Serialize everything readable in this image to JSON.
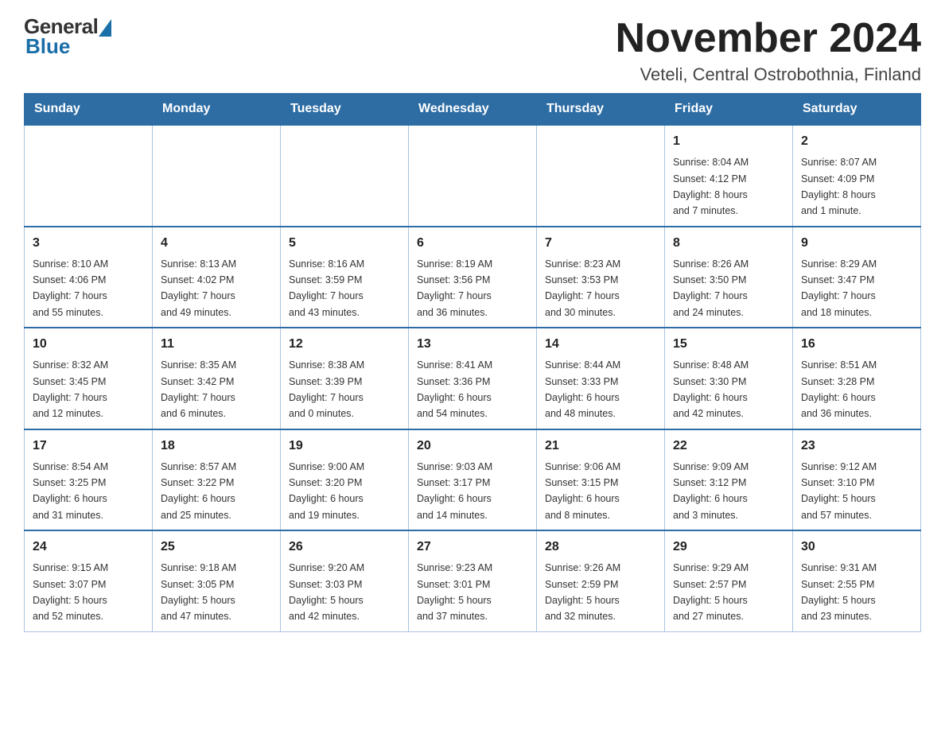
{
  "header": {
    "logo_general": "General",
    "logo_blue": "Blue",
    "month_title": "November 2024",
    "location": "Veteli, Central Ostrobothnia, Finland"
  },
  "weekdays": [
    "Sunday",
    "Monday",
    "Tuesday",
    "Wednesday",
    "Thursday",
    "Friday",
    "Saturday"
  ],
  "weeks": [
    [
      {
        "day": "",
        "info": ""
      },
      {
        "day": "",
        "info": ""
      },
      {
        "day": "",
        "info": ""
      },
      {
        "day": "",
        "info": ""
      },
      {
        "day": "",
        "info": ""
      },
      {
        "day": "1",
        "info": "Sunrise: 8:04 AM\nSunset: 4:12 PM\nDaylight: 8 hours\nand 7 minutes."
      },
      {
        "day": "2",
        "info": "Sunrise: 8:07 AM\nSunset: 4:09 PM\nDaylight: 8 hours\nand 1 minute."
      }
    ],
    [
      {
        "day": "3",
        "info": "Sunrise: 8:10 AM\nSunset: 4:06 PM\nDaylight: 7 hours\nand 55 minutes."
      },
      {
        "day": "4",
        "info": "Sunrise: 8:13 AM\nSunset: 4:02 PM\nDaylight: 7 hours\nand 49 minutes."
      },
      {
        "day": "5",
        "info": "Sunrise: 8:16 AM\nSunset: 3:59 PM\nDaylight: 7 hours\nand 43 minutes."
      },
      {
        "day": "6",
        "info": "Sunrise: 8:19 AM\nSunset: 3:56 PM\nDaylight: 7 hours\nand 36 minutes."
      },
      {
        "day": "7",
        "info": "Sunrise: 8:23 AM\nSunset: 3:53 PM\nDaylight: 7 hours\nand 30 minutes."
      },
      {
        "day": "8",
        "info": "Sunrise: 8:26 AM\nSunset: 3:50 PM\nDaylight: 7 hours\nand 24 minutes."
      },
      {
        "day": "9",
        "info": "Sunrise: 8:29 AM\nSunset: 3:47 PM\nDaylight: 7 hours\nand 18 minutes."
      }
    ],
    [
      {
        "day": "10",
        "info": "Sunrise: 8:32 AM\nSunset: 3:45 PM\nDaylight: 7 hours\nand 12 minutes."
      },
      {
        "day": "11",
        "info": "Sunrise: 8:35 AM\nSunset: 3:42 PM\nDaylight: 7 hours\nand 6 minutes."
      },
      {
        "day": "12",
        "info": "Sunrise: 8:38 AM\nSunset: 3:39 PM\nDaylight: 7 hours\nand 0 minutes."
      },
      {
        "day": "13",
        "info": "Sunrise: 8:41 AM\nSunset: 3:36 PM\nDaylight: 6 hours\nand 54 minutes."
      },
      {
        "day": "14",
        "info": "Sunrise: 8:44 AM\nSunset: 3:33 PM\nDaylight: 6 hours\nand 48 minutes."
      },
      {
        "day": "15",
        "info": "Sunrise: 8:48 AM\nSunset: 3:30 PM\nDaylight: 6 hours\nand 42 minutes."
      },
      {
        "day": "16",
        "info": "Sunrise: 8:51 AM\nSunset: 3:28 PM\nDaylight: 6 hours\nand 36 minutes."
      }
    ],
    [
      {
        "day": "17",
        "info": "Sunrise: 8:54 AM\nSunset: 3:25 PM\nDaylight: 6 hours\nand 31 minutes."
      },
      {
        "day": "18",
        "info": "Sunrise: 8:57 AM\nSunset: 3:22 PM\nDaylight: 6 hours\nand 25 minutes."
      },
      {
        "day": "19",
        "info": "Sunrise: 9:00 AM\nSunset: 3:20 PM\nDaylight: 6 hours\nand 19 minutes."
      },
      {
        "day": "20",
        "info": "Sunrise: 9:03 AM\nSunset: 3:17 PM\nDaylight: 6 hours\nand 14 minutes."
      },
      {
        "day": "21",
        "info": "Sunrise: 9:06 AM\nSunset: 3:15 PM\nDaylight: 6 hours\nand 8 minutes."
      },
      {
        "day": "22",
        "info": "Sunrise: 9:09 AM\nSunset: 3:12 PM\nDaylight: 6 hours\nand 3 minutes."
      },
      {
        "day": "23",
        "info": "Sunrise: 9:12 AM\nSunset: 3:10 PM\nDaylight: 5 hours\nand 57 minutes."
      }
    ],
    [
      {
        "day": "24",
        "info": "Sunrise: 9:15 AM\nSunset: 3:07 PM\nDaylight: 5 hours\nand 52 minutes."
      },
      {
        "day": "25",
        "info": "Sunrise: 9:18 AM\nSunset: 3:05 PM\nDaylight: 5 hours\nand 47 minutes."
      },
      {
        "day": "26",
        "info": "Sunrise: 9:20 AM\nSunset: 3:03 PM\nDaylight: 5 hours\nand 42 minutes."
      },
      {
        "day": "27",
        "info": "Sunrise: 9:23 AM\nSunset: 3:01 PM\nDaylight: 5 hours\nand 37 minutes."
      },
      {
        "day": "28",
        "info": "Sunrise: 9:26 AM\nSunset: 2:59 PM\nDaylight: 5 hours\nand 32 minutes."
      },
      {
        "day": "29",
        "info": "Sunrise: 9:29 AM\nSunset: 2:57 PM\nDaylight: 5 hours\nand 27 minutes."
      },
      {
        "day": "30",
        "info": "Sunrise: 9:31 AM\nSunset: 2:55 PM\nDaylight: 5 hours\nand 23 minutes."
      }
    ]
  ]
}
